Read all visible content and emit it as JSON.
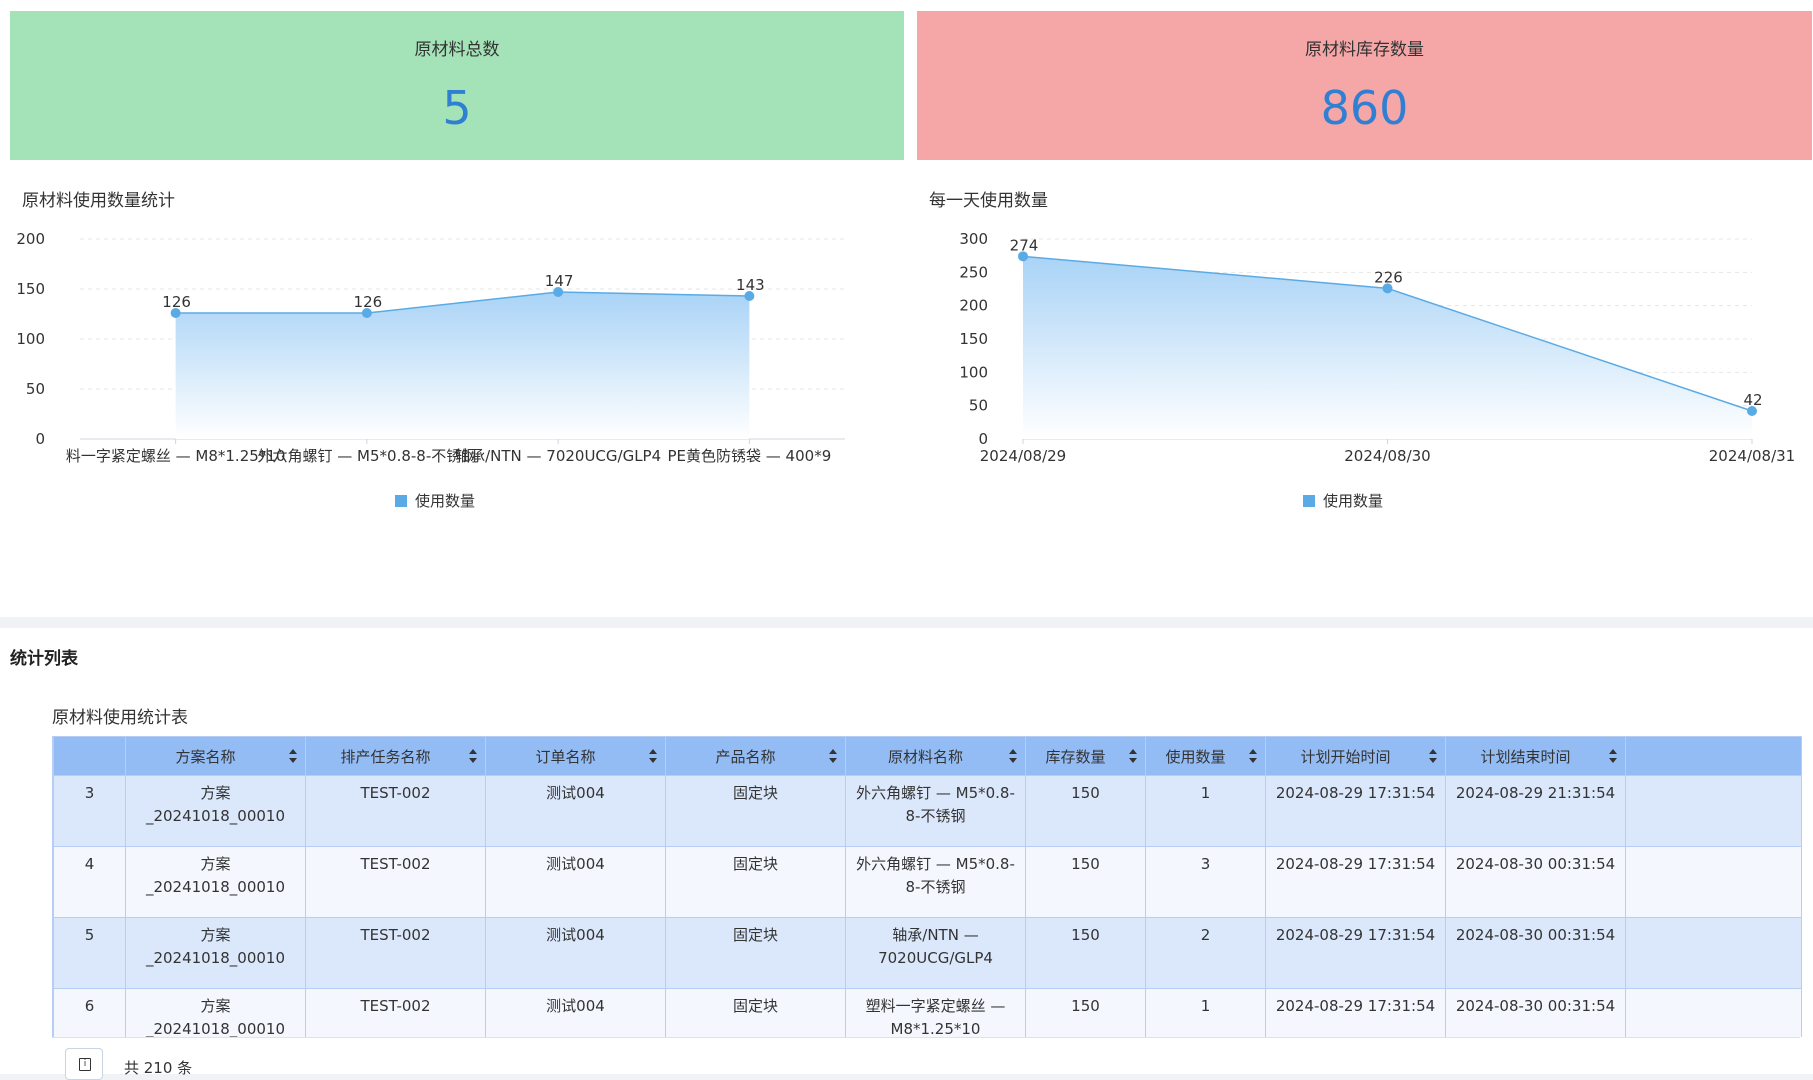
{
  "cards": [
    {
      "title": "原材料总数",
      "value": "5",
      "bg": "#a4e3b7"
    },
    {
      "title": "原材料库存数量",
      "value": "860",
      "bg": "#f5a7a7"
    }
  ],
  "charts": {
    "left_title": "原材料使用数量统计",
    "right_title": "每一天使用数量",
    "legend_label": "使用数量",
    "color": "#5aabe5"
  },
  "chart_data": [
    {
      "type": "area",
      "title": "原材料使用数量统计",
      "categories": [
        "料一字紧定螺丝 — M8*1.25*10",
        "外六角螺钉 — M5*0.8-8-不锈钢",
        "轴承/NTN — 7020UCG/GLP4",
        "PE黄色防锈袋 — 400*9"
      ],
      "series": [
        {
          "name": "使用数量",
          "values": [
            126,
            126,
            147,
            143
          ]
        }
      ],
      "ylim": [
        0,
        200
      ],
      "yticks": [
        0,
        50,
        100,
        150,
        200
      ],
      "legend": "bottom-center",
      "grid": true
    },
    {
      "type": "area",
      "title": "每一天使用数量",
      "categories": [
        "2024/08/29",
        "2024/08/30",
        "2024/08/31"
      ],
      "series": [
        {
          "name": "使用数量",
          "values": [
            274,
            226,
            42
          ]
        }
      ],
      "ylim": [
        0,
        300
      ],
      "yticks": [
        0,
        50,
        100,
        150,
        200,
        250,
        300
      ],
      "legend": "bottom-center",
      "grid": true
    }
  ],
  "section_title": "统计列表",
  "table": {
    "title": "原材料使用统计表",
    "headers": [
      "方案名称",
      "排产任务名称",
      "订单名称",
      "产品名称",
      "原材料名称",
      "库存数量",
      "使用数量",
      "计划开始时间",
      "计划结束时间"
    ],
    "rows": [
      {
        "idx": "3",
        "cells": [
          "方案_20241018_00010",
          "TEST-002",
          "测试004",
          "固定块",
          "外六角螺钉 — M5*0.8-8-不锈钢",
          "150",
          "1",
          "2024-08-29 17:31:54",
          "2024-08-29 21:31:54"
        ]
      },
      {
        "idx": "4",
        "cells": [
          "方案_20241018_00010",
          "TEST-002",
          "测试004",
          "固定块",
          "外六角螺钉 — M5*0.8-8-不锈钢",
          "150",
          "3",
          "2024-08-29 17:31:54",
          "2024-08-30 00:31:54"
        ]
      },
      {
        "idx": "5",
        "cells": [
          "方案_20241018_00010",
          "TEST-002",
          "测试004",
          "固定块",
          "轴承/NTN — 7020UCG/GLP4",
          "150",
          "2",
          "2024-08-29 17:31:54",
          "2024-08-30 00:31:54"
        ]
      },
      {
        "idx": "6",
        "cells": [
          "方案_20241018_00010",
          "TEST-002",
          "测试004",
          "固定块",
          "塑料一字紧定螺丝 — M8*1.25*10",
          "150",
          "1",
          "2024-08-29 17:31:54",
          "2024-08-30 00:31:54"
        ]
      }
    ],
    "total_text": "共 210 条",
    "pager_icon": "page-icon",
    "header_bg": "#94bcf4"
  }
}
